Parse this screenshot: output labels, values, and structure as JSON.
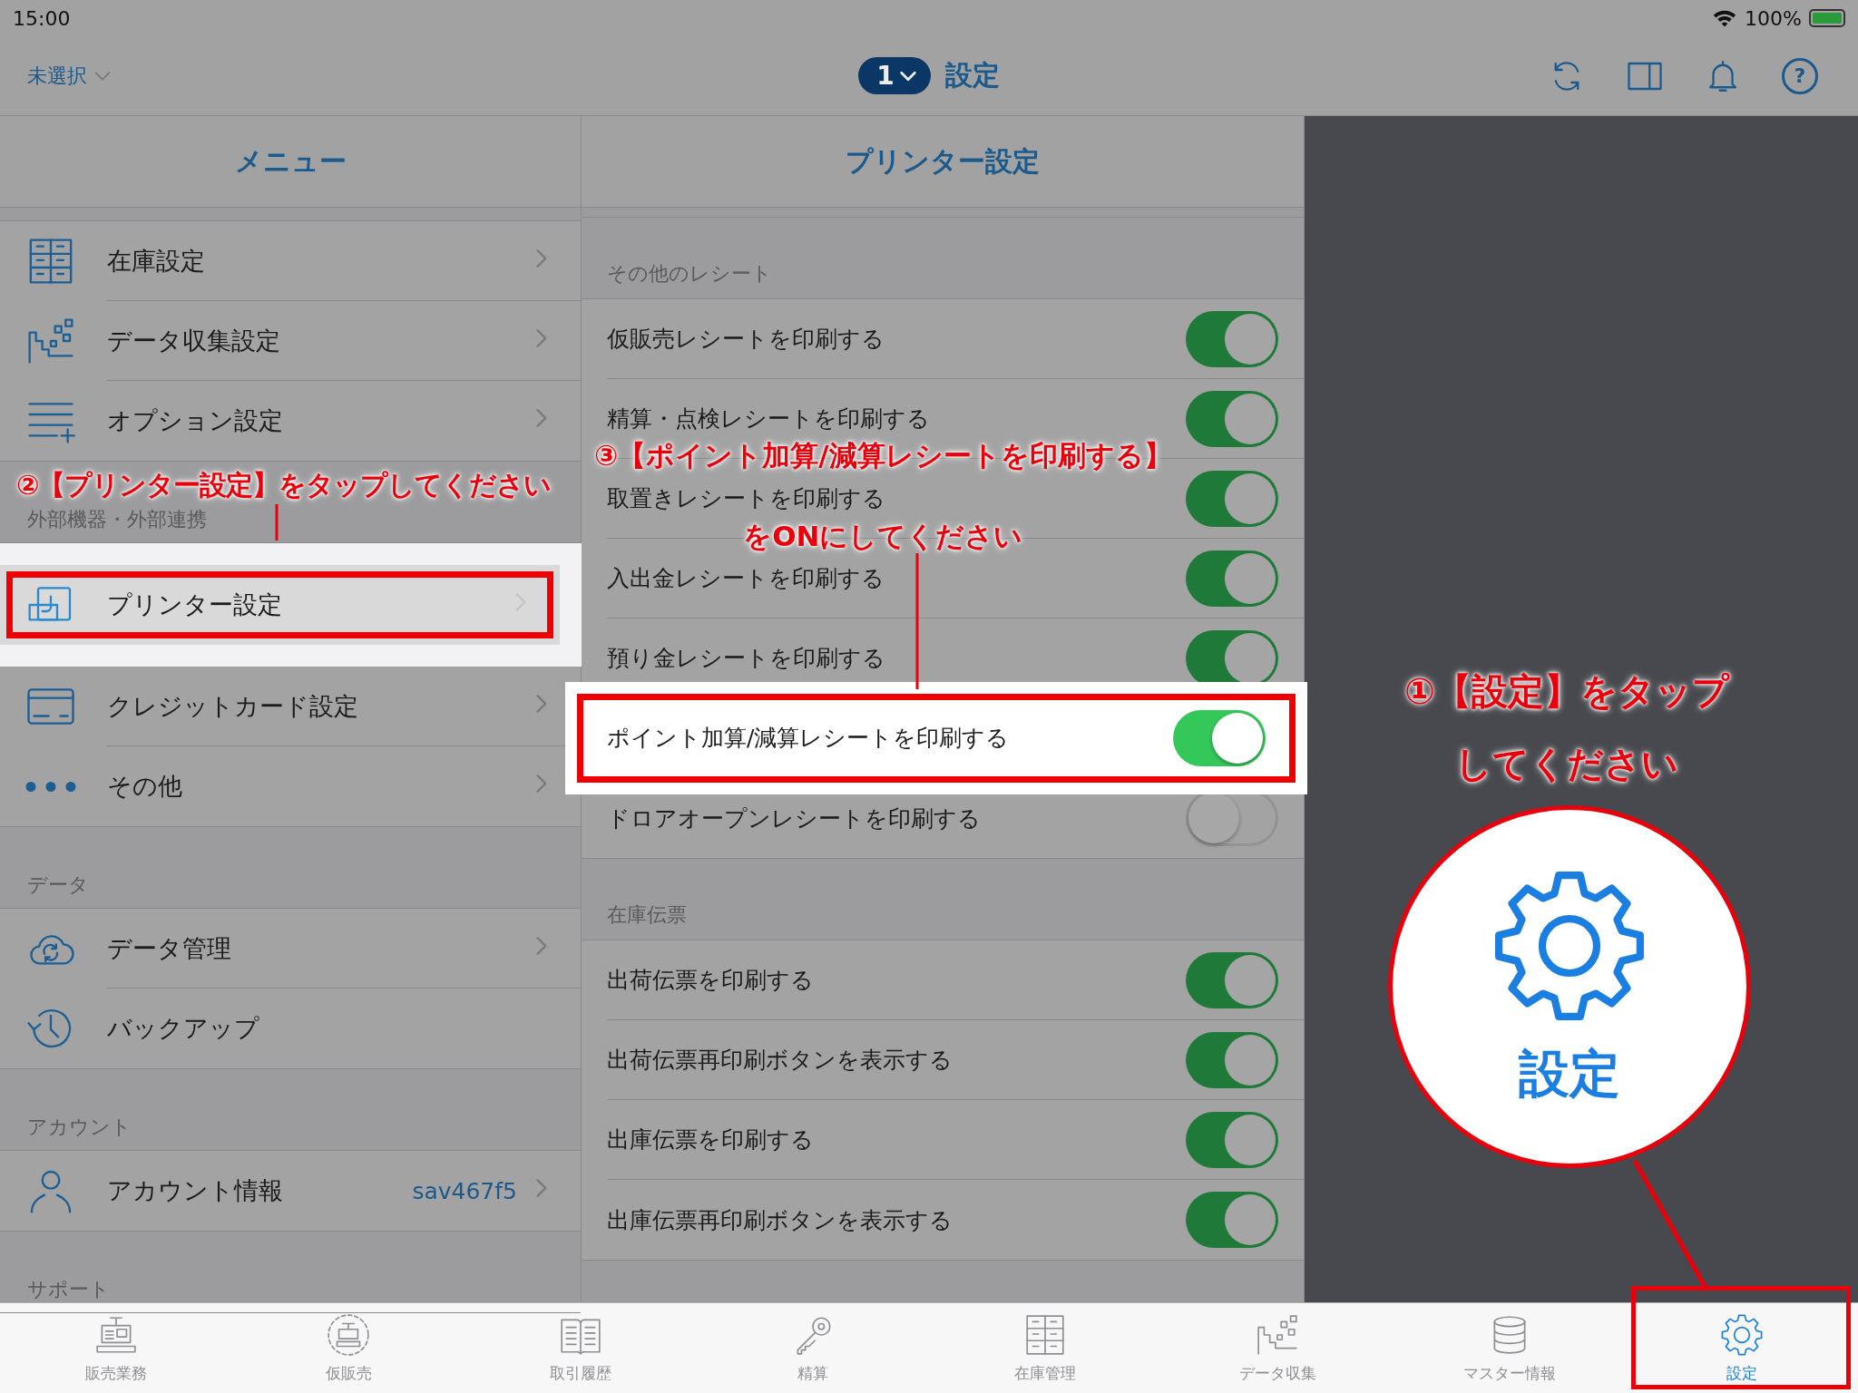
{
  "status_bar": {
    "time": "15:00",
    "battery": "100%"
  },
  "nav_bar": {
    "store": "未選択",
    "register": "1",
    "title": "設定",
    "help": "?"
  },
  "menu": {
    "title": "メニュー",
    "sections": [
      {
        "items": [
          {
            "kind": "stock",
            "label": "在庫設定",
            "chevron": true,
            "spotlight": false
          },
          {
            "kind": "collect",
            "label": "データ収集設定",
            "chevron": true,
            "spotlight": false
          },
          {
            "kind": "options",
            "label": "オプション設定",
            "chevron": true,
            "spotlight": false
          }
        ]
      },
      {
        "header": "外部機器・外部連携",
        "items": [
          {
            "kind": "printer",
            "label": "プリンター設定",
            "chevron": true,
            "spotlight": true
          },
          {
            "kind": "card",
            "label": "クレジットカード設定",
            "chevron": true,
            "spotlight": false
          },
          {
            "kind": "more",
            "label": "その他",
            "chevron": true,
            "spotlight": false
          }
        ]
      },
      {
        "header": "データ",
        "items": [
          {
            "kind": "cloud",
            "label": "データ管理",
            "chevron": true,
            "spotlight": false
          },
          {
            "kind": "history",
            "label": "バックアップ",
            "chevron": false,
            "spotlight": false
          }
        ]
      },
      {
        "header": "アカウント",
        "items": [
          {
            "kind": "person",
            "label": "アカウント情報",
            "value": "sav467f5",
            "chevron": true,
            "spotlight": false
          }
        ]
      },
      {
        "header": "サポート"
      }
    ]
  },
  "printer": {
    "title": "プリンター設定",
    "sections": [
      {
        "header": "その他のレシート",
        "rows": [
          {
            "label": "仮販売レシートを印刷する",
            "on": true,
            "spotlight": false
          },
          {
            "label": "精算・点検レシートを印刷する",
            "on": true,
            "spotlight": false
          },
          {
            "label": "取置きレシートを印刷する",
            "on": true,
            "spotlight": false
          },
          {
            "label": "入出金レシートを印刷する",
            "on": true,
            "spotlight": false
          },
          {
            "label": "預り金レシートを印刷する",
            "on": true,
            "spotlight": false
          },
          {
            "label": "ポイント加算/減算レシートを印刷する",
            "on": true,
            "spotlight": true
          },
          {
            "label": "ドロアオープンレシートを印刷する",
            "on": false,
            "spotlight": false
          }
        ]
      },
      {
        "header": "在庫伝票",
        "rows": [
          {
            "label": "出荷伝票を印刷する",
            "on": true,
            "spotlight": false
          },
          {
            "label": "出荷伝票再印刷ボタンを表示する",
            "on": true,
            "spotlight": false
          },
          {
            "label": "出庫伝票を印刷する",
            "on": true,
            "spotlight": false
          },
          {
            "label": "出庫伝票再印刷ボタンを表示する",
            "on": true,
            "spotlight": false
          }
        ]
      }
    ]
  },
  "tab_bar": {
    "tabs": [
      {
        "kind": "register",
        "label": "販売業務",
        "selected": false
      },
      {
        "kind": "temp",
        "label": "仮販売",
        "selected": false
      },
      {
        "kind": "ledger",
        "label": "取引履歴",
        "selected": false
      },
      {
        "kind": "key",
        "label": "精算",
        "selected": false
      },
      {
        "kind": "stock",
        "label": "在庫管理",
        "selected": false
      },
      {
        "kind": "collect",
        "label": "データ収集",
        "selected": false
      },
      {
        "kind": "database",
        "label": "マスター情報",
        "selected": false
      },
      {
        "kind": "gear",
        "label": "設定",
        "selected": true
      }
    ]
  },
  "tutorial": {
    "callouts": [
      {
        "lines": [
          "②【プリンター設定】をタップしてください"
        ]
      },
      {
        "lines": [
          "③【ポイント加算/減算レシートを印刷する】",
          "をONにしてください"
        ]
      },
      {
        "lines": [
          "①【設定】をタップ",
          "してください"
        ]
      }
    ],
    "magnifier": {
      "label": "設定"
    }
  }
}
